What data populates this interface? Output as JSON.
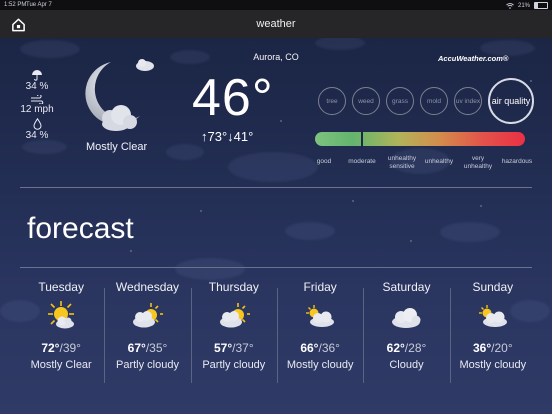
{
  "status_bar": {
    "time": "1:52 PM",
    "date": "Tue Apr 7",
    "battery": "21%"
  },
  "nav": {
    "title": "weather",
    "home_icon": "home-icon"
  },
  "current": {
    "precip_chance": "34 %",
    "wind": "12 mph",
    "humidity": "34 %",
    "condition": "Mostly Clear",
    "location": "Aurora, CO",
    "temperature": "46°",
    "hi_lo": "↑73°↓41°"
  },
  "air_quality": {
    "brand": "AccuWeather.com®",
    "categories": [
      "tree",
      "weed",
      "grass",
      "mold",
      "uv index",
      "air quality"
    ],
    "active_category": "air quality",
    "scale_labels": [
      "good",
      "moderate",
      "unhealthy sensitive",
      "unhealthy",
      "very unhealthy",
      "hazardous"
    ],
    "current_level": "moderate",
    "colors": {
      "good": "#63b56e",
      "moderate": "#b1b35a",
      "hazardous": "#ea3045"
    }
  },
  "forecast": {
    "title": "forecast",
    "days": [
      {
        "name": "Tuesday",
        "hi": "72°",
        "lo": "39°",
        "condition": "Mostly Clear",
        "icon": "sun-cloud-icon"
      },
      {
        "name": "Wednesday",
        "hi": "67°",
        "lo": "35°",
        "condition": "Partly cloudy",
        "icon": "sun-cloud-icon"
      },
      {
        "name": "Thursday",
        "hi": "57°",
        "lo": "37°",
        "condition": "Partly cloudy",
        "icon": "sun-cloud-icon"
      },
      {
        "name": "Friday",
        "hi": "66°",
        "lo": "36°",
        "condition": "Mostly cloudy",
        "icon": "sun-cloud-icon"
      },
      {
        "name": "Saturday",
        "hi": "62°",
        "lo": "28°",
        "condition": "Cloudy",
        "icon": "cloud-icon"
      },
      {
        "name": "Sunday",
        "hi": "36°",
        "lo": "20°",
        "condition": "Mostly cloudy",
        "icon": "sun-cloud-icon"
      }
    ]
  }
}
